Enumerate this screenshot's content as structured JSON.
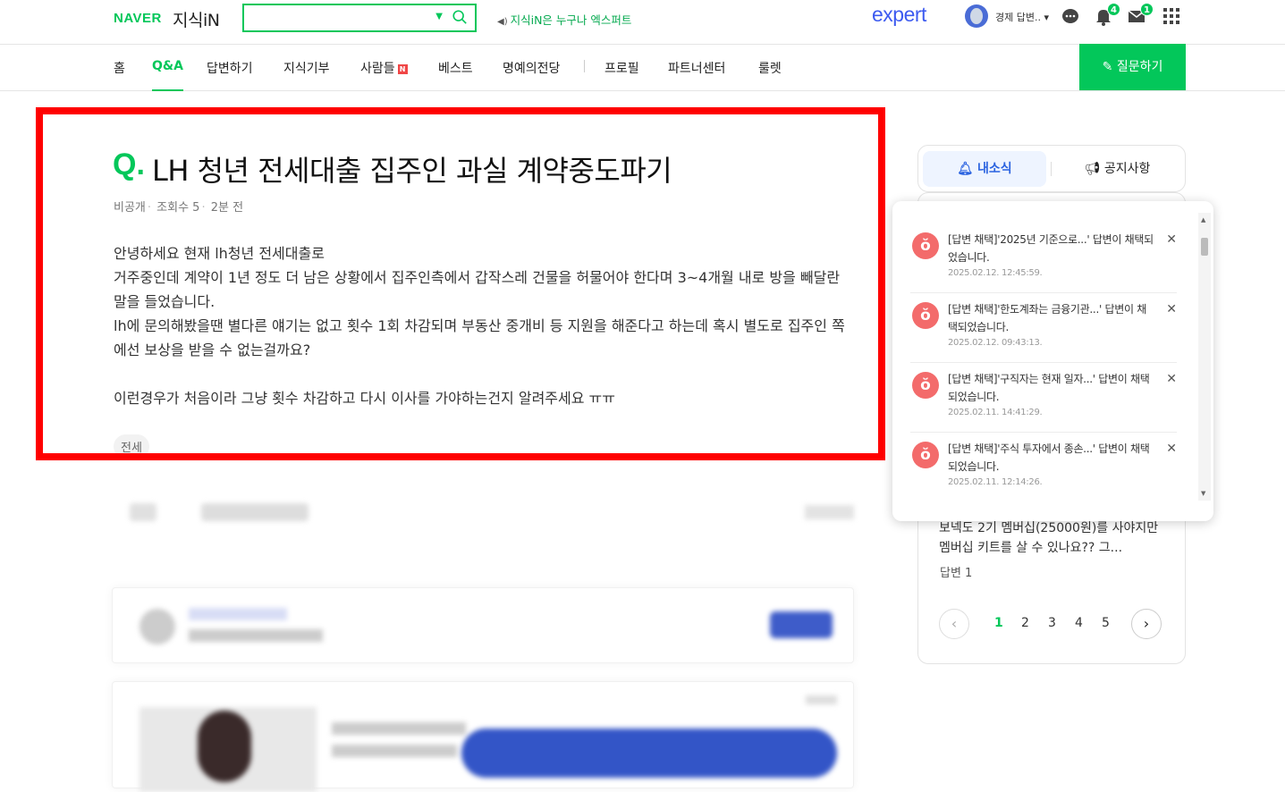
{
  "header": {
    "logo_naver": "NAVER",
    "logo_kin": "지식iN",
    "search_placeholder": "",
    "tagline": "지식iN은 누구나 엑스퍼트",
    "expert_logo": "expert",
    "user_name": "경제 답변..",
    "notification_count": "4",
    "mail_count": "1"
  },
  "nav": {
    "items": [
      "홈",
      "Q&A",
      "답변하기",
      "지식기부",
      "사람들",
      "베스트",
      "명예의전당",
      "프로필",
      "파트너센터",
      "룰렛"
    ],
    "new_badge": "N",
    "active": "Q&A",
    "ask_button": "질문하기"
  },
  "question": {
    "q_mark": "Q.",
    "title": "LH 청년 전세대출 집주인 과실 계약중도파기",
    "meta": {
      "visibility": "비공개",
      "views": "조회수 5",
      "time": "2분 전"
    },
    "body": [
      "안녕하세요 현재 lh청년 전세대출로",
      "거주중인데 계약이 1년 정도 더 남은 상황에서 집주인측에서 갑작스레 건물을 허물어야 한다며 3~4개월 내로 방을 빼달란 말을 들었습니다.",
      "lh에 문의해봤을땐 별다른 얘기는 없고 횟수 1회 차감되며 부동산 중개비 등 지원을 해준다고 하는데 혹시 별도로 집주인 쪽에선 보상을 받을 수 없는걸까요?",
      "",
      "이런경우가 처음이라 그냥 횟수 차감하고 다시 이사를 가야하는건지 알려주세요 ㅠㅠ"
    ],
    "tag": "전세"
  },
  "side": {
    "tab_active": "내소식",
    "tab_other": "공지사항",
    "preview_text": "보넥도 2기 멤버십(25000원)를 사야지만 멤버십 키트를 살 수 있나요?? 그...",
    "preview_answers": "답변 1",
    "pages": [
      "1",
      "2",
      "3",
      "4",
      "5"
    ],
    "active_page": "1"
  },
  "notifications": [
    {
      "text": "[답변 채택]'2025년 기준으로...' 답변이 채택되었습니다.",
      "date": "2025.02.12. 12:45:59."
    },
    {
      "text": "[답변 채택]'한도계좌는 금융기관...' 답변이 채택되었습니다.",
      "date": "2025.02.12. 09:43:13."
    },
    {
      "text": "[답변 채택]'구직자는 현재 일자...' 답변이 채택되었습니다.",
      "date": "2025.02.11. 14:41:29."
    },
    {
      "text": "[답변 채택]'주식 투자에서 종손...' 답변이 채택되었습니다.",
      "date": "2025.02.11. 12:14:26."
    }
  ],
  "colors": {
    "brand": "#03c75a",
    "highlight_frame": "#ff0000",
    "expert": "#3d5bf0",
    "notif_icon": "#f36b6b"
  }
}
